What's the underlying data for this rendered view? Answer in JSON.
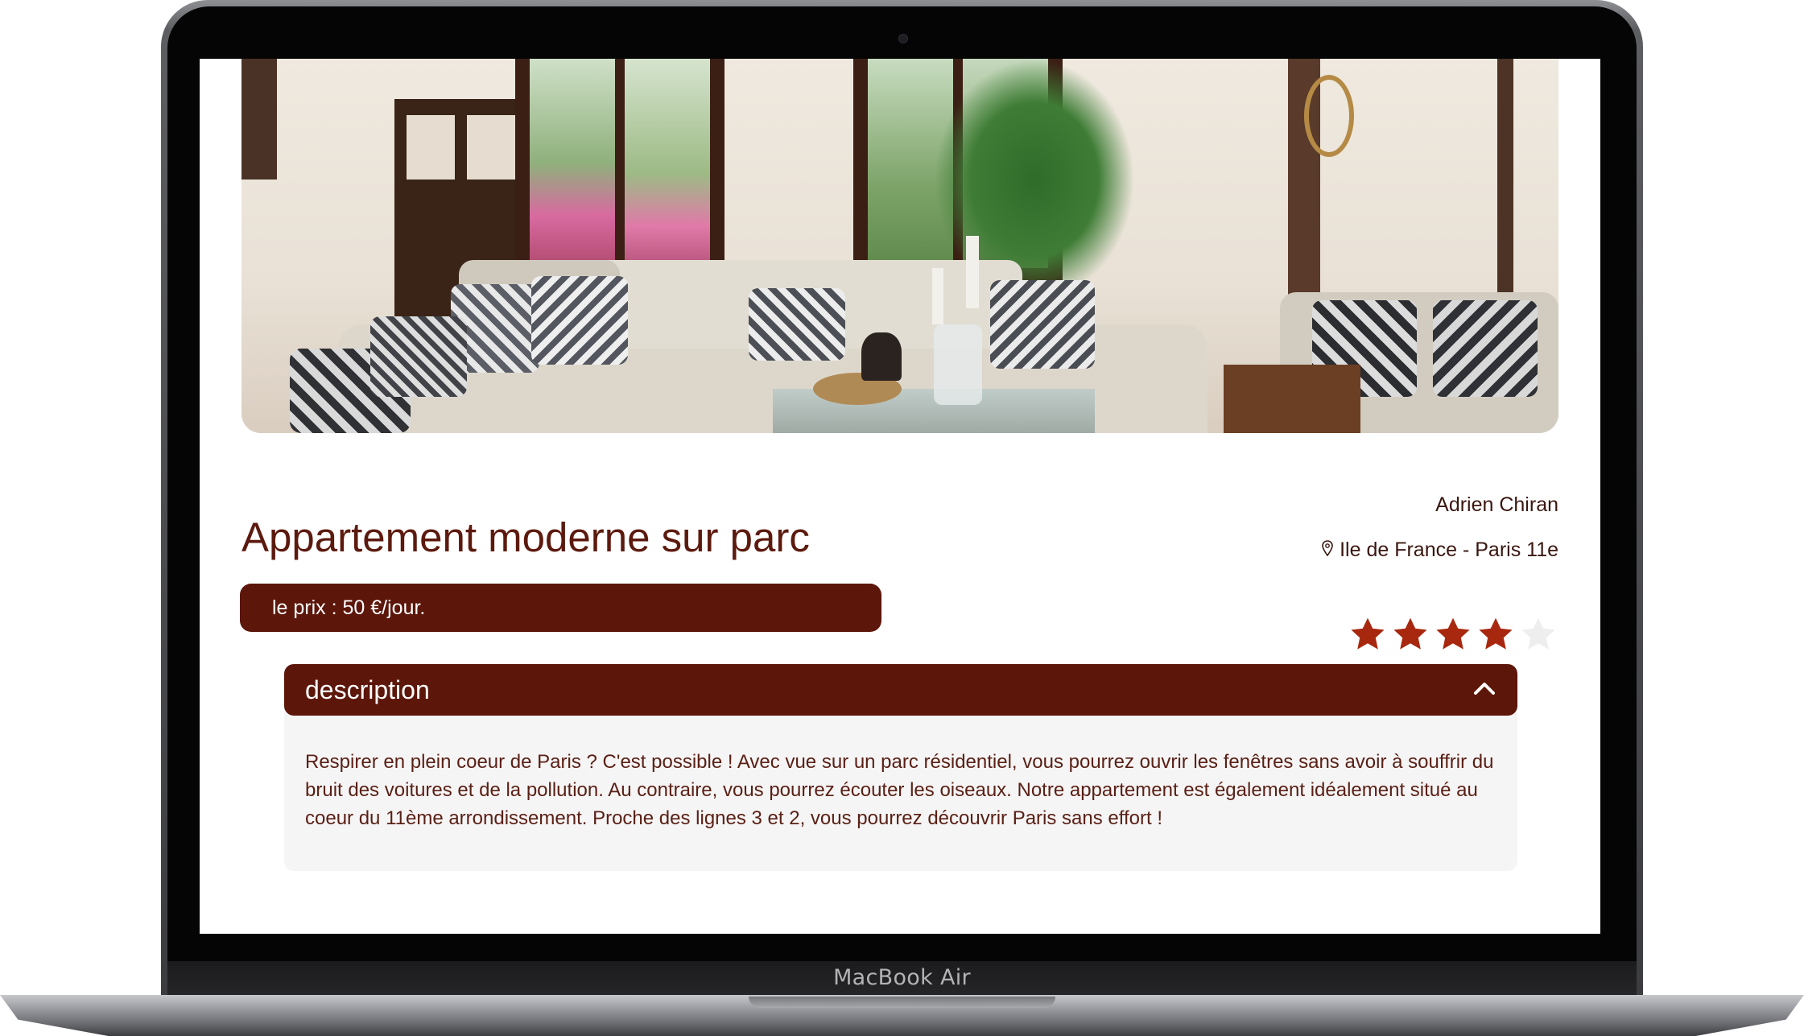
{
  "device": {
    "model_label": "MacBook Air"
  },
  "listing": {
    "title": "Appartement moderne sur parc",
    "price_text": "le prix : 50 €/jour.",
    "host_name": "Adrien Chiran",
    "location": "Ile de France - Paris 11e",
    "rating": {
      "value": 4,
      "max": 5,
      "filled_color": "#a8280f",
      "empty_color": "#eeeeee"
    },
    "description": {
      "heading": "description",
      "expanded": true,
      "text": "Respirer en plein coeur de Paris ? C'est possible ! Avec vue sur un parc résidentiel, vous pourrez ouvrir les fenêtres sans avoir à souffrir du bruit des voitures et de la pollution. Au contraire, vous pourrez écouter les oiseaux. Notre appartement est également idéalement situé au coeur du 11ème arrondissement. Proche des lignes 3 et 2, vous pourrez découvrir Paris sans effort !"
    }
  },
  "icons": {
    "location": "map-pin-icon",
    "toggle": "chevron-up-icon",
    "rating": "star-icon"
  },
  "colors": {
    "brand": "#5c160a",
    "title_text": "#5c1a0e",
    "body_text": "#5a2016"
  }
}
